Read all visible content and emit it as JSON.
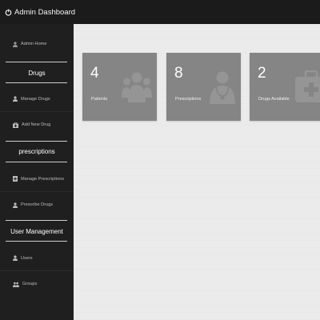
{
  "app": {
    "title": "Admin Dashboard"
  },
  "sidebar": {
    "admin_home": "Admin Home",
    "sections": [
      {
        "heading": "Drugs",
        "items": [
          "Manage Drugs",
          "Add New Drug"
        ]
      },
      {
        "heading": "prescriptions",
        "items": [
          "Manage Prescriptions",
          "Prescribe Drugs"
        ]
      },
      {
        "heading": "User Management",
        "items": [
          "Users",
          "Groups"
        ]
      }
    ]
  },
  "cards": [
    {
      "value": "4",
      "label": "Patients",
      "icon": "users-icon"
    },
    {
      "value": "8",
      "label": "Prescriptions",
      "icon": "doctor-icon"
    },
    {
      "value": "2",
      "label": "Drugs Available",
      "icon": "first-aid-kit-icon"
    }
  ],
  "colors": {
    "topbar": "#1b1b1b",
    "sidebar": "#1f1f1f",
    "card": "#858585",
    "main_bg": "#ebebeb"
  }
}
